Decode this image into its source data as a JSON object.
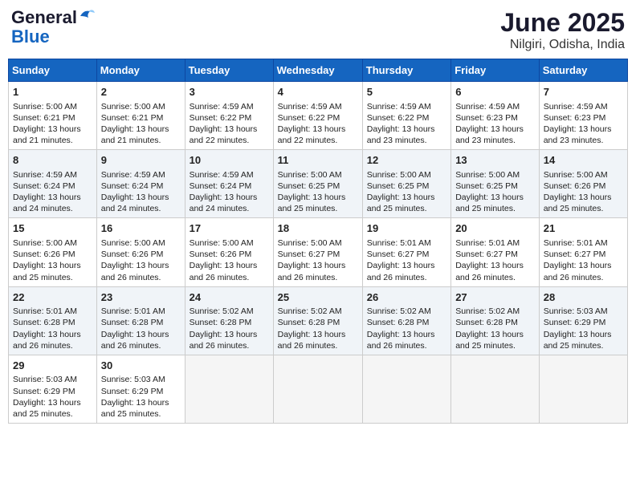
{
  "logo": {
    "general": "General",
    "blue": "Blue"
  },
  "title": {
    "month_year": "June 2025",
    "location": "Nilgiri, Odisha, India"
  },
  "days_of_week": [
    "Sunday",
    "Monday",
    "Tuesday",
    "Wednesday",
    "Thursday",
    "Friday",
    "Saturday"
  ],
  "weeks": [
    [
      {
        "day": "1",
        "sunrise": "5:00 AM",
        "sunset": "6:21 PM",
        "daylight": "13 hours and 21 minutes."
      },
      {
        "day": "2",
        "sunrise": "5:00 AM",
        "sunset": "6:21 PM",
        "daylight": "13 hours and 21 minutes."
      },
      {
        "day": "3",
        "sunrise": "4:59 AM",
        "sunset": "6:22 PM",
        "daylight": "13 hours and 22 minutes."
      },
      {
        "day": "4",
        "sunrise": "4:59 AM",
        "sunset": "6:22 PM",
        "daylight": "13 hours and 22 minutes."
      },
      {
        "day": "5",
        "sunrise": "4:59 AM",
        "sunset": "6:22 PM",
        "daylight": "13 hours and 23 minutes."
      },
      {
        "day": "6",
        "sunrise": "4:59 AM",
        "sunset": "6:23 PM",
        "daylight": "13 hours and 23 minutes."
      },
      {
        "day": "7",
        "sunrise": "4:59 AM",
        "sunset": "6:23 PM",
        "daylight": "13 hours and 23 minutes."
      }
    ],
    [
      {
        "day": "8",
        "sunrise": "4:59 AM",
        "sunset": "6:24 PM",
        "daylight": "13 hours and 24 minutes."
      },
      {
        "day": "9",
        "sunrise": "4:59 AM",
        "sunset": "6:24 PM",
        "daylight": "13 hours and 24 minutes."
      },
      {
        "day": "10",
        "sunrise": "4:59 AM",
        "sunset": "6:24 PM",
        "daylight": "13 hours and 24 minutes."
      },
      {
        "day": "11",
        "sunrise": "5:00 AM",
        "sunset": "6:25 PM",
        "daylight": "13 hours and 25 minutes."
      },
      {
        "day": "12",
        "sunrise": "5:00 AM",
        "sunset": "6:25 PM",
        "daylight": "13 hours and 25 minutes."
      },
      {
        "day": "13",
        "sunrise": "5:00 AM",
        "sunset": "6:25 PM",
        "daylight": "13 hours and 25 minutes."
      },
      {
        "day": "14",
        "sunrise": "5:00 AM",
        "sunset": "6:26 PM",
        "daylight": "13 hours and 25 minutes."
      }
    ],
    [
      {
        "day": "15",
        "sunrise": "5:00 AM",
        "sunset": "6:26 PM",
        "daylight": "13 hours and 25 minutes."
      },
      {
        "day": "16",
        "sunrise": "5:00 AM",
        "sunset": "6:26 PM",
        "daylight": "13 hours and 26 minutes."
      },
      {
        "day": "17",
        "sunrise": "5:00 AM",
        "sunset": "6:26 PM",
        "daylight": "13 hours and 26 minutes."
      },
      {
        "day": "18",
        "sunrise": "5:00 AM",
        "sunset": "6:27 PM",
        "daylight": "13 hours and 26 minutes."
      },
      {
        "day": "19",
        "sunrise": "5:01 AM",
        "sunset": "6:27 PM",
        "daylight": "13 hours and 26 minutes."
      },
      {
        "day": "20",
        "sunrise": "5:01 AM",
        "sunset": "6:27 PM",
        "daylight": "13 hours and 26 minutes."
      },
      {
        "day": "21",
        "sunrise": "5:01 AM",
        "sunset": "6:27 PM",
        "daylight": "13 hours and 26 minutes."
      }
    ],
    [
      {
        "day": "22",
        "sunrise": "5:01 AM",
        "sunset": "6:28 PM",
        "daylight": "13 hours and 26 minutes."
      },
      {
        "day": "23",
        "sunrise": "5:01 AM",
        "sunset": "6:28 PM",
        "daylight": "13 hours and 26 minutes."
      },
      {
        "day": "24",
        "sunrise": "5:02 AM",
        "sunset": "6:28 PM",
        "daylight": "13 hours and 26 minutes."
      },
      {
        "day": "25",
        "sunrise": "5:02 AM",
        "sunset": "6:28 PM",
        "daylight": "13 hours and 26 minutes."
      },
      {
        "day": "26",
        "sunrise": "5:02 AM",
        "sunset": "6:28 PM",
        "daylight": "13 hours and 26 minutes."
      },
      {
        "day": "27",
        "sunrise": "5:02 AM",
        "sunset": "6:28 PM",
        "daylight": "13 hours and 25 minutes."
      },
      {
        "day": "28",
        "sunrise": "5:03 AM",
        "sunset": "6:29 PM",
        "daylight": "13 hours and 25 minutes."
      }
    ],
    [
      {
        "day": "29",
        "sunrise": "5:03 AM",
        "sunset": "6:29 PM",
        "daylight": "13 hours and 25 minutes."
      },
      {
        "day": "30",
        "sunrise": "5:03 AM",
        "sunset": "6:29 PM",
        "daylight": "13 hours and 25 minutes."
      },
      null,
      null,
      null,
      null,
      null
    ]
  ]
}
